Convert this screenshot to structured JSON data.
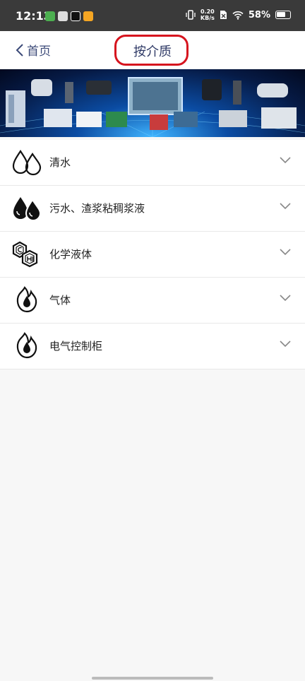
{
  "status_bar": {
    "time": "12:13",
    "net_speed_value": "0.20",
    "net_speed_unit": "KB/s",
    "battery": "58%"
  },
  "header": {
    "back_label": "首页",
    "title": "按介质"
  },
  "colors": {
    "highlight": "#d6141e",
    "accent": "#2f3a66"
  },
  "media_list": [
    {
      "label": "清水",
      "icon": "double-drop-outline-icon"
    },
    {
      "label": "污水、渣浆粘稠浆液",
      "icon": "double-drop-filled-icon"
    },
    {
      "label": "化学液体",
      "icon": "chemical-hexagon-icon"
    },
    {
      "label": "气体",
      "icon": "flame-drop-icon"
    },
    {
      "label": "电气控制柜",
      "icon": "flame-drop-icon"
    }
  ]
}
